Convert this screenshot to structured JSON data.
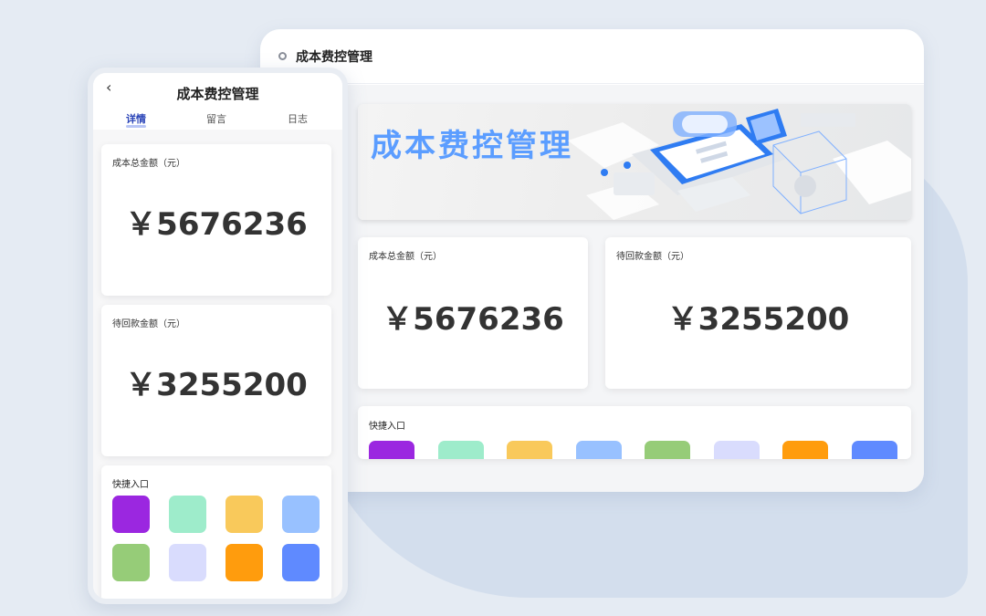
{
  "desktop": {
    "header_title": "成本费控管理",
    "banner_title": "成本费控管理",
    "cards": [
      {
        "label": "成本总金额（元）",
        "value": "￥5676236"
      },
      {
        "label": "待回款金额（元）",
        "value": "￥3255200"
      }
    ],
    "quick_label": "快捷入口"
  },
  "phone": {
    "back_glyph": "‹",
    "title": "成本费控管理",
    "tabs": [
      "详情",
      "留言",
      "日志"
    ],
    "active_tab": "详情",
    "cards": [
      {
        "label": "成本总金额（元）",
        "value": "￥5676236"
      },
      {
        "label": "待回款金额（元）",
        "value": "￥3255200"
      }
    ],
    "quick_label": "快捷入口"
  },
  "tile_colors": [
    "#9b27e0",
    "#9eeccb",
    "#f9c95b",
    "#98c1ff",
    "#96cc78",
    "#d9dcfd",
    "#ff9c0d",
    "#5f8aff"
  ],
  "accent": "#5b9dff"
}
